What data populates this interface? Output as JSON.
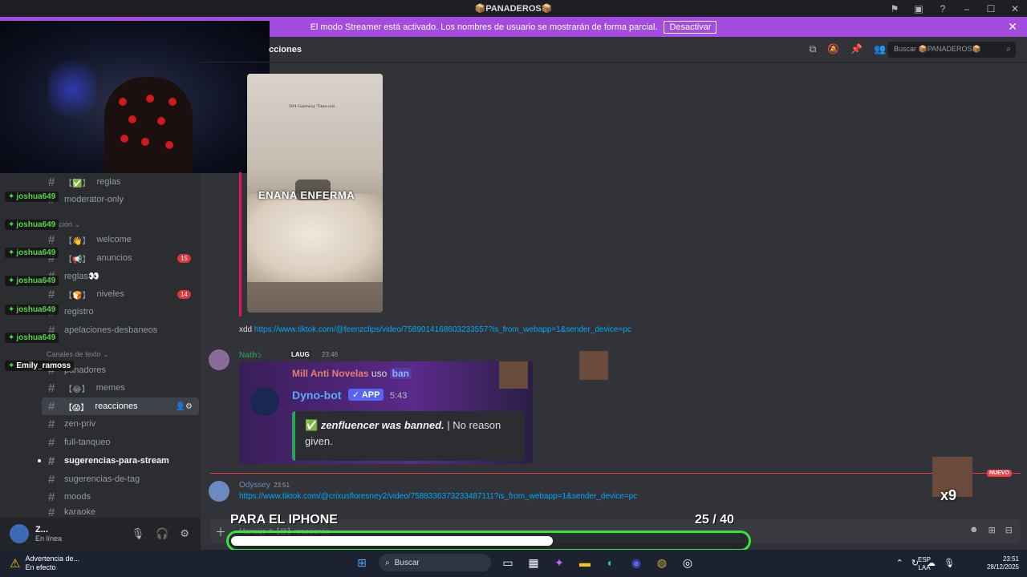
{
  "titlebar": {
    "title": "📦PANADEROS📦"
  },
  "banner": {
    "message": "El modo Streamer está activado. Los nombres de usuario se mostrarán de forma parcial.",
    "button": "Desactivar"
  },
  "header": {
    "channel_name_partial": "cciones",
    "search_placeholder": "Buscar 📦PANADEROS📦"
  },
  "sidebar": {
    "categories": [
      {
        "label": "rmación ⌄"
      },
      {
        "label": "Canales de texto ⌄"
      }
    ],
    "channels": [
      {
        "label": "reglas",
        "emoji": "【✅】"
      },
      {
        "label": "moderator-only",
        "emoji": ""
      },
      {
        "label": "welcome",
        "emoji": "【👋】"
      },
      {
        "label": "anuncios",
        "emoji": "【📢】",
        "badge": "15"
      },
      {
        "label": "reglas👀",
        "emoji": ""
      },
      {
        "label": "niveles",
        "emoji": "【🍞】",
        "badge": "14"
      },
      {
        "label": "registro",
        "emoji": ""
      },
      {
        "label": "apelaciones-desbaneos",
        "emoji": ""
      },
      {
        "label": "panadores",
        "emoji": ""
      },
      {
        "label": "memes",
        "emoji": "【😂】"
      },
      {
        "label": "reacciones",
        "emoji": "【😱】"
      },
      {
        "label": "zen-priv",
        "emoji": ""
      },
      {
        "label": "full-tanqueo",
        "emoji": ""
      },
      {
        "label": "sugerencias-para-stream",
        "emoji": ""
      },
      {
        "label": "sugerencias-de-tag",
        "emoji": ""
      },
      {
        "label": "moods",
        "emoji": ""
      },
      {
        "label": "karaoke",
        "emoji": ""
      }
    ]
  },
  "stream_chat": {
    "users": [
      "joshua649",
      "joshua649",
      "joshua649",
      "joshua649",
      "joshua649",
      "joshua649",
      "Emily_ramoss"
    ]
  },
  "user_panel": {
    "name": "Z...",
    "status": "En línea"
  },
  "messages": {
    "video_caption": "ENANA ENFERMA",
    "video_overlay_text": "504 Gateway Time-out",
    "xdd_text": "xdd",
    "xdd_link": "https://www.tiktok.com/@feenzclips/video/7589014168603233557?is_from_webapp=1&sender_device=pc",
    "nath": {
      "name": "Nath১",
      "tag": "LAUG",
      "time": "23:46"
    },
    "embed": {
      "reply_user": "Mill Anti Novelas",
      "reply_verb": "uso",
      "reply_cmd": "ban",
      "bot_name": "Dyno-bot",
      "app_badge": "✓ APP",
      "bot_time": "5:43",
      "ban_bold": "zenfluencer was banned.",
      "ban_rest": " | No reason given."
    },
    "new_badge": "NUEVO",
    "odyssey": {
      "name": "Odyssey",
      "time": "23:51",
      "link": "https://www.tiktok.com/@crixusfloresney2/video/7588336373233487111?is_from_webapp=1&sender_device=pc"
    },
    "x9": "x9"
  },
  "composer": {
    "placeholder": "Mensaje #【😱】reacciones"
  },
  "goal": {
    "label": "PARA EL IPHONE",
    "current": "25",
    "total": "/ 40",
    "progress": 0.625
  },
  "taskbar": {
    "warning_title": "Advertencia de...",
    "warning_sub": "En efecto",
    "search": "Buscar",
    "lang_top": "ESP",
    "lang_bottom": "LAA",
    "time": "23:51",
    "date": "28/12/2025"
  }
}
